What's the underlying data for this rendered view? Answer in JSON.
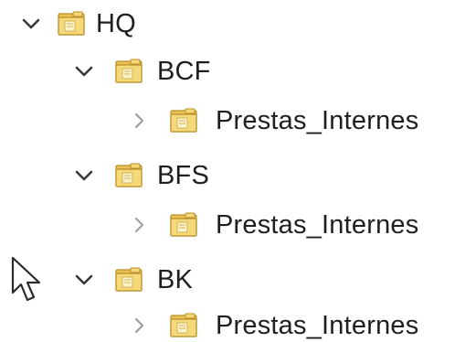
{
  "tree": {
    "nodes": [
      {
        "label": "HQ",
        "state": "expanded",
        "icon": "folder-icon"
      },
      {
        "label": "BCF",
        "state": "expanded",
        "icon": "folder-icon"
      },
      {
        "label": "Prestas_Internes",
        "state": "collapsed",
        "icon": "folder-icon"
      },
      {
        "label": "BFS",
        "state": "expanded",
        "icon": "folder-icon"
      },
      {
        "label": "Prestas_Internes",
        "state": "collapsed",
        "icon": "folder-icon"
      },
      {
        "label": "BK",
        "state": "expanded",
        "icon": "folder-icon"
      },
      {
        "label": "Prestas_Internes",
        "state": "collapsed",
        "icon": "folder-icon"
      }
    ]
  },
  "colors": {
    "folder_fill": "#f3d36b",
    "folder_edge": "#c9a23a",
    "chevron_expanded": "#3a3a3a",
    "chevron_collapsed": "#9a9a9a",
    "text": "#1f1f1f"
  },
  "cursor": {
    "icon": "mouse-pointer-icon"
  }
}
